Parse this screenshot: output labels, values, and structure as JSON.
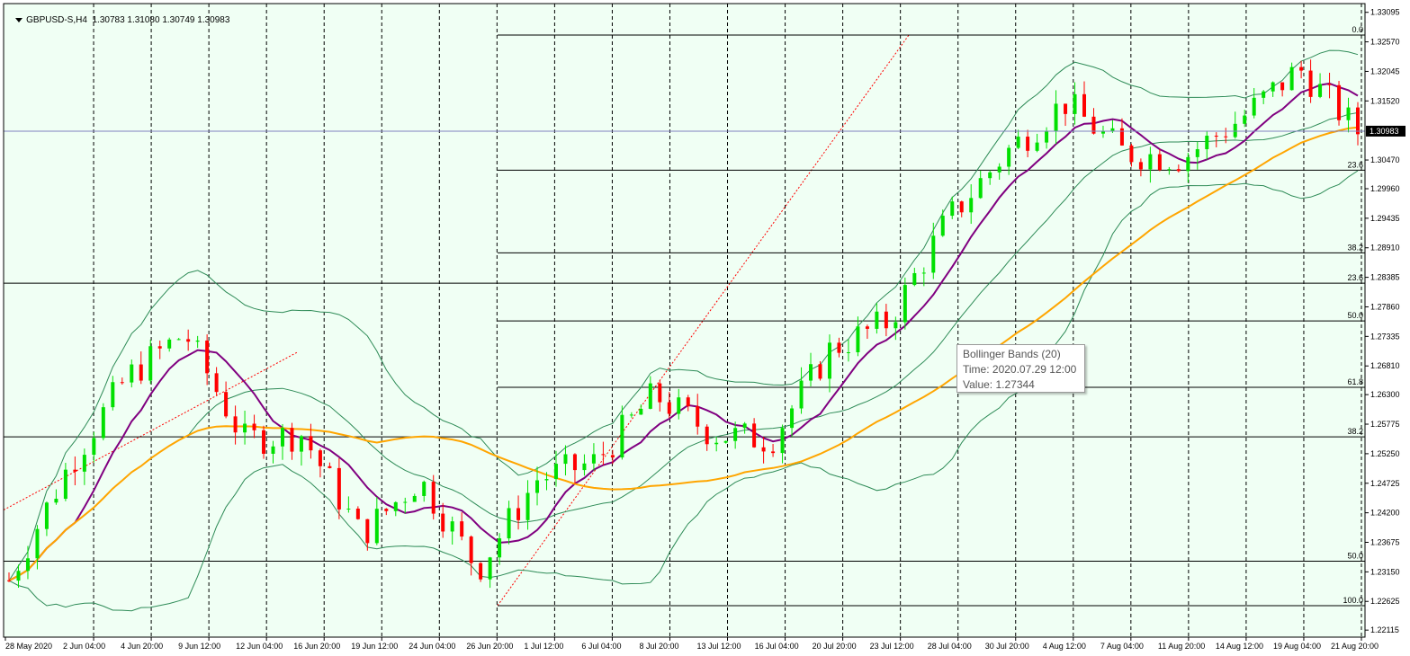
{
  "header": {
    "symbol_timeframe": "GBPUSD-S,H4",
    "ohlc": "1.30783 1.31080 1.30749 1.30983"
  },
  "current_price_label": "1.30983",
  "tooltip": {
    "line1": "Bollinger Bands (20)",
    "line2": "Time: 2020.07.29 12:00",
    "line3": "Value: 1.27344"
  },
  "colors": {
    "background": "#f0fff4",
    "bull_candle": "#00e000",
    "bear_candle": "#ff0000",
    "bollinger": "#2e8b57",
    "ma_fast": "#800080",
    "ma_slow": "#ffa500",
    "fib_trend": "#ff0000",
    "fib_levels": "#000000",
    "grid": "#000000",
    "bid_line": "#8080c0"
  },
  "chart_data": {
    "type": "candlestick",
    "symbol": "GBPUSD-S",
    "timeframe": "H4",
    "x_labels": [
      "28 May 2020",
      "2 Jun 04:00",
      "4 Jun 20:00",
      "9 Jun 12:00",
      "12 Jun 04:00",
      "16 Jun 20:00",
      "19 Jun 12:00",
      "24 Jun 04:00",
      "26 Jun 20:00",
      "1 Jul 12:00",
      "6 Jul 04:00",
      "8 Jul 20:00",
      "13 Jul 12:00",
      "16 Jul 04:00",
      "20 Jul 20:00",
      "23 Jul 12:00",
      "28 Jul 04:00",
      "30 Jul 20:00",
      "4 Aug 12:00",
      "7 Aug 04:00",
      "11 Aug 20:00",
      "14 Aug 12:00",
      "19 Aug 04:00",
      "21 Aug 20:00"
    ],
    "y_ticks": [
      "1.33095",
      "1.32570",
      "1.32045",
      "1.31520",
      "1.30470",
      "1.29960",
      "1.29435",
      "1.28910",
      "1.28385",
      "1.27860",
      "1.27335",
      "1.26810",
      "1.26300",
      "1.25775",
      "1.25250",
      "1.24725",
      "1.24200",
      "1.23675",
      "1.23150",
      "1.22625",
      "1.22115"
    ],
    "ylim": [
      1.2199,
      1.3325
    ],
    "indicators": [
      "Bollinger Bands (20)",
      "MA fast",
      "MA slow"
    ],
    "fib_set_1": {
      "levels": [
        {
          "label": "0.0",
          "price": 1.3269
        },
        {
          "label": "23.6",
          "price": 1.3029
        },
        {
          "label": "38.2",
          "price": 1.2882
        },
        {
          "label": "50.0",
          "price": 1.2761
        },
        {
          "label": "61.8",
          "price": 1.2643
        },
        {
          "label": "100.0",
          "price": 1.2255
        }
      ]
    },
    "fib_set_2": {
      "levels": [
        {
          "label": "23.6",
          "price": 1.2828
        },
        {
          "label": "38.2",
          "price": 1.2555
        },
        {
          "label": "50.0",
          "price": 1.2334
        }
      ]
    },
    "key_points": [
      {
        "x": "28 May 2020",
        "close": 1.23
      },
      {
        "x": "2 Jun 04:00",
        "close": 1.25
      },
      {
        "x": "4 Jun 20:00",
        "close": 1.266
      },
      {
        "x": "9 Jun 12:00",
        "close": 1.274
      },
      {
        "x": "12 Jun 04:00",
        "close": 1.255
      },
      {
        "x": "16 Jun 20:00",
        "close": 1.256
      },
      {
        "x": "19 Jun 12:00",
        "close": 1.238
      },
      {
        "x": "24 Jun 04:00",
        "close": 1.248
      },
      {
        "x": "26 Jun 20:00",
        "close": 1.232
      },
      {
        "x": "1 Jul 12:00",
        "close": 1.248
      },
      {
        "x": "6 Jul 04:00",
        "close": 1.251
      },
      {
        "x": "8 Jul 20:00",
        "close": 1.263
      },
      {
        "x": "13 Jul 12:00",
        "close": 1.256
      },
      {
        "x": "16 Jul 04:00",
        "close": 1.255
      },
      {
        "x": "20 Jul 20:00",
        "close": 1.271
      },
      {
        "x": "23 Jul 12:00",
        "close": 1.276
      },
      {
        "x": "28 Jul 04:00",
        "close": 1.294
      },
      {
        "x": "30 Jul 20:00",
        "close": 1.306
      },
      {
        "x": "4 Aug 12:00",
        "close": 1.315
      },
      {
        "x": "7 Aug 04:00",
        "close": 1.306
      },
      {
        "x": "11 Aug 20:00",
        "close": 1.305
      },
      {
        "x": "14 Aug 12:00",
        "close": 1.312
      },
      {
        "x": "19 Aug 04:00",
        "close": 1.321
      },
      {
        "x": "21 Aug 20:00",
        "close": 1.3098
      }
    ]
  }
}
